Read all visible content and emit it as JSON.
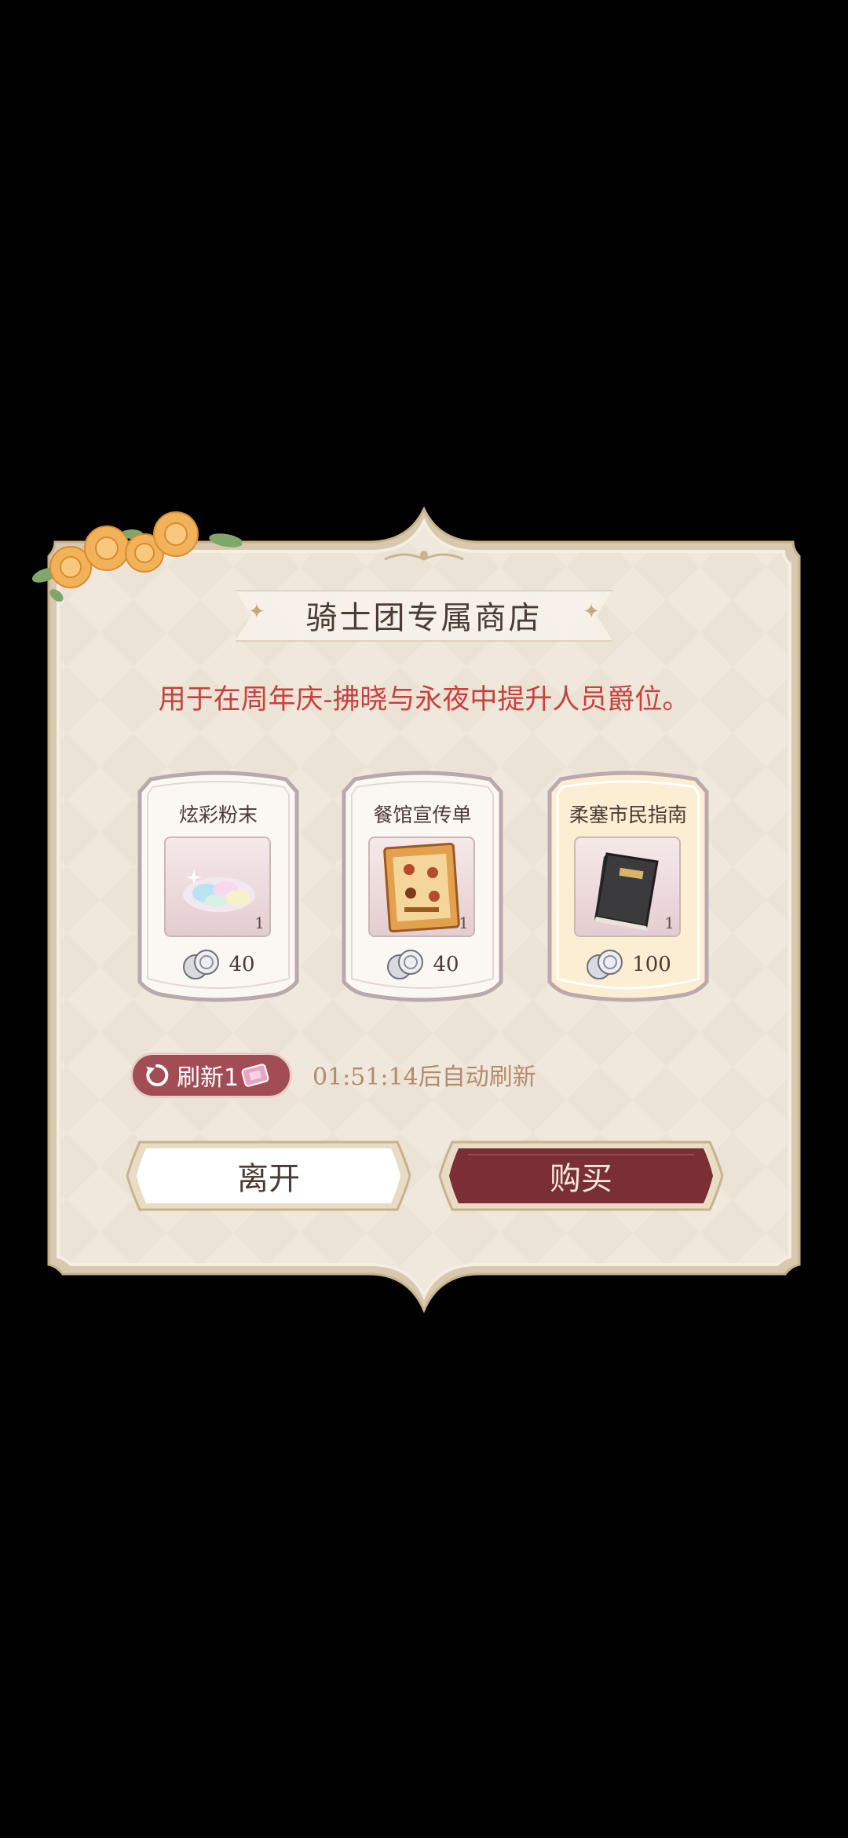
{
  "shop": {
    "title": "骑士团专属商店",
    "description": "用于在周年庆-拂晓与永夜中提升人员爵位。"
  },
  "items": [
    {
      "name": "炫彩粉末",
      "quantity": "1",
      "price": "40",
      "icon": "rainbow-powder-icon",
      "selected": false
    },
    {
      "name": "餐馆宣传单",
      "quantity": "1",
      "price": "40",
      "icon": "restaurant-flyer-icon",
      "selected": false
    },
    {
      "name": "柔塞市民指南",
      "quantity": "1",
      "price": "100",
      "icon": "citizen-guide-book-icon",
      "selected": true
    }
  ],
  "refresh": {
    "label": "刷新1",
    "countdown": "01:51:14后自动刷新"
  },
  "buttons": {
    "leave": "离开",
    "buy": "购买"
  },
  "colors": {
    "accent_red": "#c8413e",
    "buy_button": "#7a2f36",
    "refresh_button": "#a24d56",
    "selected_card": "#fbeed2",
    "panel": "#efe8dc"
  }
}
